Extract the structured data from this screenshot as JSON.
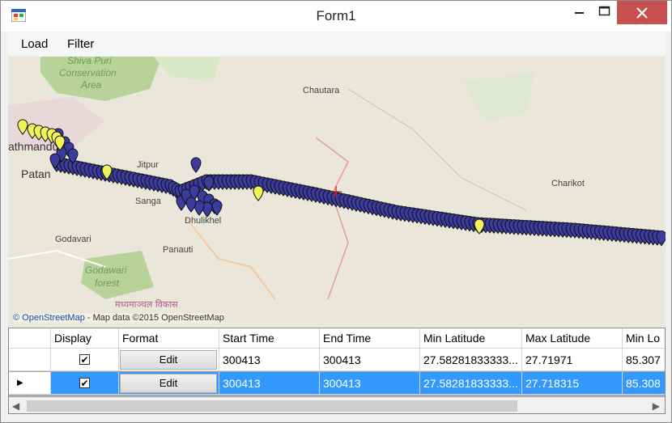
{
  "window": {
    "title": "Form1"
  },
  "menu": {
    "items": [
      "Load",
      "Filter"
    ]
  },
  "map": {
    "labels": [
      {
        "text": "Shiva Puri",
        "style": "area"
      },
      {
        "text": "Conservation",
        "style": "area"
      },
      {
        "text": "Area",
        "style": "area"
      },
      {
        "text": "Chautara",
        "style": "town"
      },
      {
        "text": "athmandu",
        "style": "city"
      },
      {
        "text": "Patan",
        "style": "city"
      },
      {
        "text": "Jitpur",
        "style": "town"
      },
      {
        "text": "Sanga",
        "style": "town"
      },
      {
        "text": "Dhulikhel",
        "style": "town"
      },
      {
        "text": "Charikot",
        "style": "town"
      },
      {
        "text": "Godavari",
        "style": "town"
      },
      {
        "text": "Panauti",
        "style": "town"
      },
      {
        "text": "Godawari",
        "style": "area"
      },
      {
        "text": "forest",
        "style": "area"
      },
      {
        "text": "मध्यमाञ्चल विकास",
        "style": "region"
      }
    ],
    "attribution_os": "© OpenStreetMap",
    "attribution_rest": " - Map data ©2015 OpenStreetMap",
    "colors": {
      "track_marker": "#3b3ba0",
      "highlight_marker": "#f2f25a",
      "cursor": "#d22020"
    }
  },
  "grid": {
    "columns": [
      "",
      "Display",
      "Format",
      "Start Time",
      "End Time",
      "Min Latitude",
      "Max Latitude",
      "Min Lo"
    ],
    "rows": [
      {
        "selected": false,
        "display": true,
        "format": "Edit",
        "start_time": "300413",
        "end_time": "300413",
        "min_lat": "27.58281833333...",
        "max_lat": "27.71971",
        "min_lon": "85.307"
      },
      {
        "selected": true,
        "display": true,
        "format": "Edit",
        "start_time": "300413",
        "end_time": "300413",
        "min_lat": "27.58281833333...",
        "max_lat": "27.718315",
        "min_lon": "85.308"
      }
    ],
    "selection_color": "#3399ff"
  }
}
